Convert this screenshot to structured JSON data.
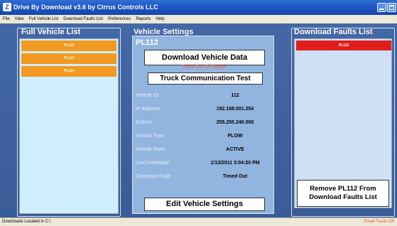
{
  "window": {
    "title": "Drive By Download v3.6 by Cirrus Controls LLC",
    "icon": "app-icon",
    "icon_glyph": "Z"
  },
  "menu": [
    "File",
    "View",
    "Full Vehicle List",
    "Download Faults List",
    "Preferences",
    "Reports",
    "Help"
  ],
  "full_vehicle_list": {
    "title": "Full Vehicle List",
    "items": [
      "PL112",
      "PL113",
      "PL114"
    ],
    "item_color": "#f29a1f"
  },
  "vehicle_settings": {
    "title": "Vehicle Settings",
    "vehicle": "PL112",
    "download_button": "Download Vehicle Data",
    "range_status": "Truck Out Of Range",
    "comm_test_button": "Truck Communication Test",
    "fields": [
      {
        "label": "Vehicle ID:",
        "value": "112"
      },
      {
        "label": "IP Address:",
        "value": "192.168.001.254"
      },
      {
        "label": "Subnet:",
        "value": "255.255.240.000"
      },
      {
        "label": "Vehicle Type:",
        "value": "PLOW"
      },
      {
        "label": "Vehicle State:",
        "value": "ACTIVE"
      },
      {
        "label": "Last Download:",
        "value": "1/13/2011 3:04:20 PM"
      },
      {
        "label": "Download Fault:",
        "value": "Timed Out"
      }
    ],
    "edit_button": "Edit Vehicle Settings"
  },
  "download_faults_list": {
    "title": "Download Faults List",
    "items": [
      "PL112"
    ],
    "item_color": "#e01e1e",
    "remove_button_line1": "Remove PL112 From",
    "remove_button_line2": "Download Faults List"
  },
  "status": {
    "left": "Downloads Located in C:\\",
    "right": "Email Faults Off"
  }
}
